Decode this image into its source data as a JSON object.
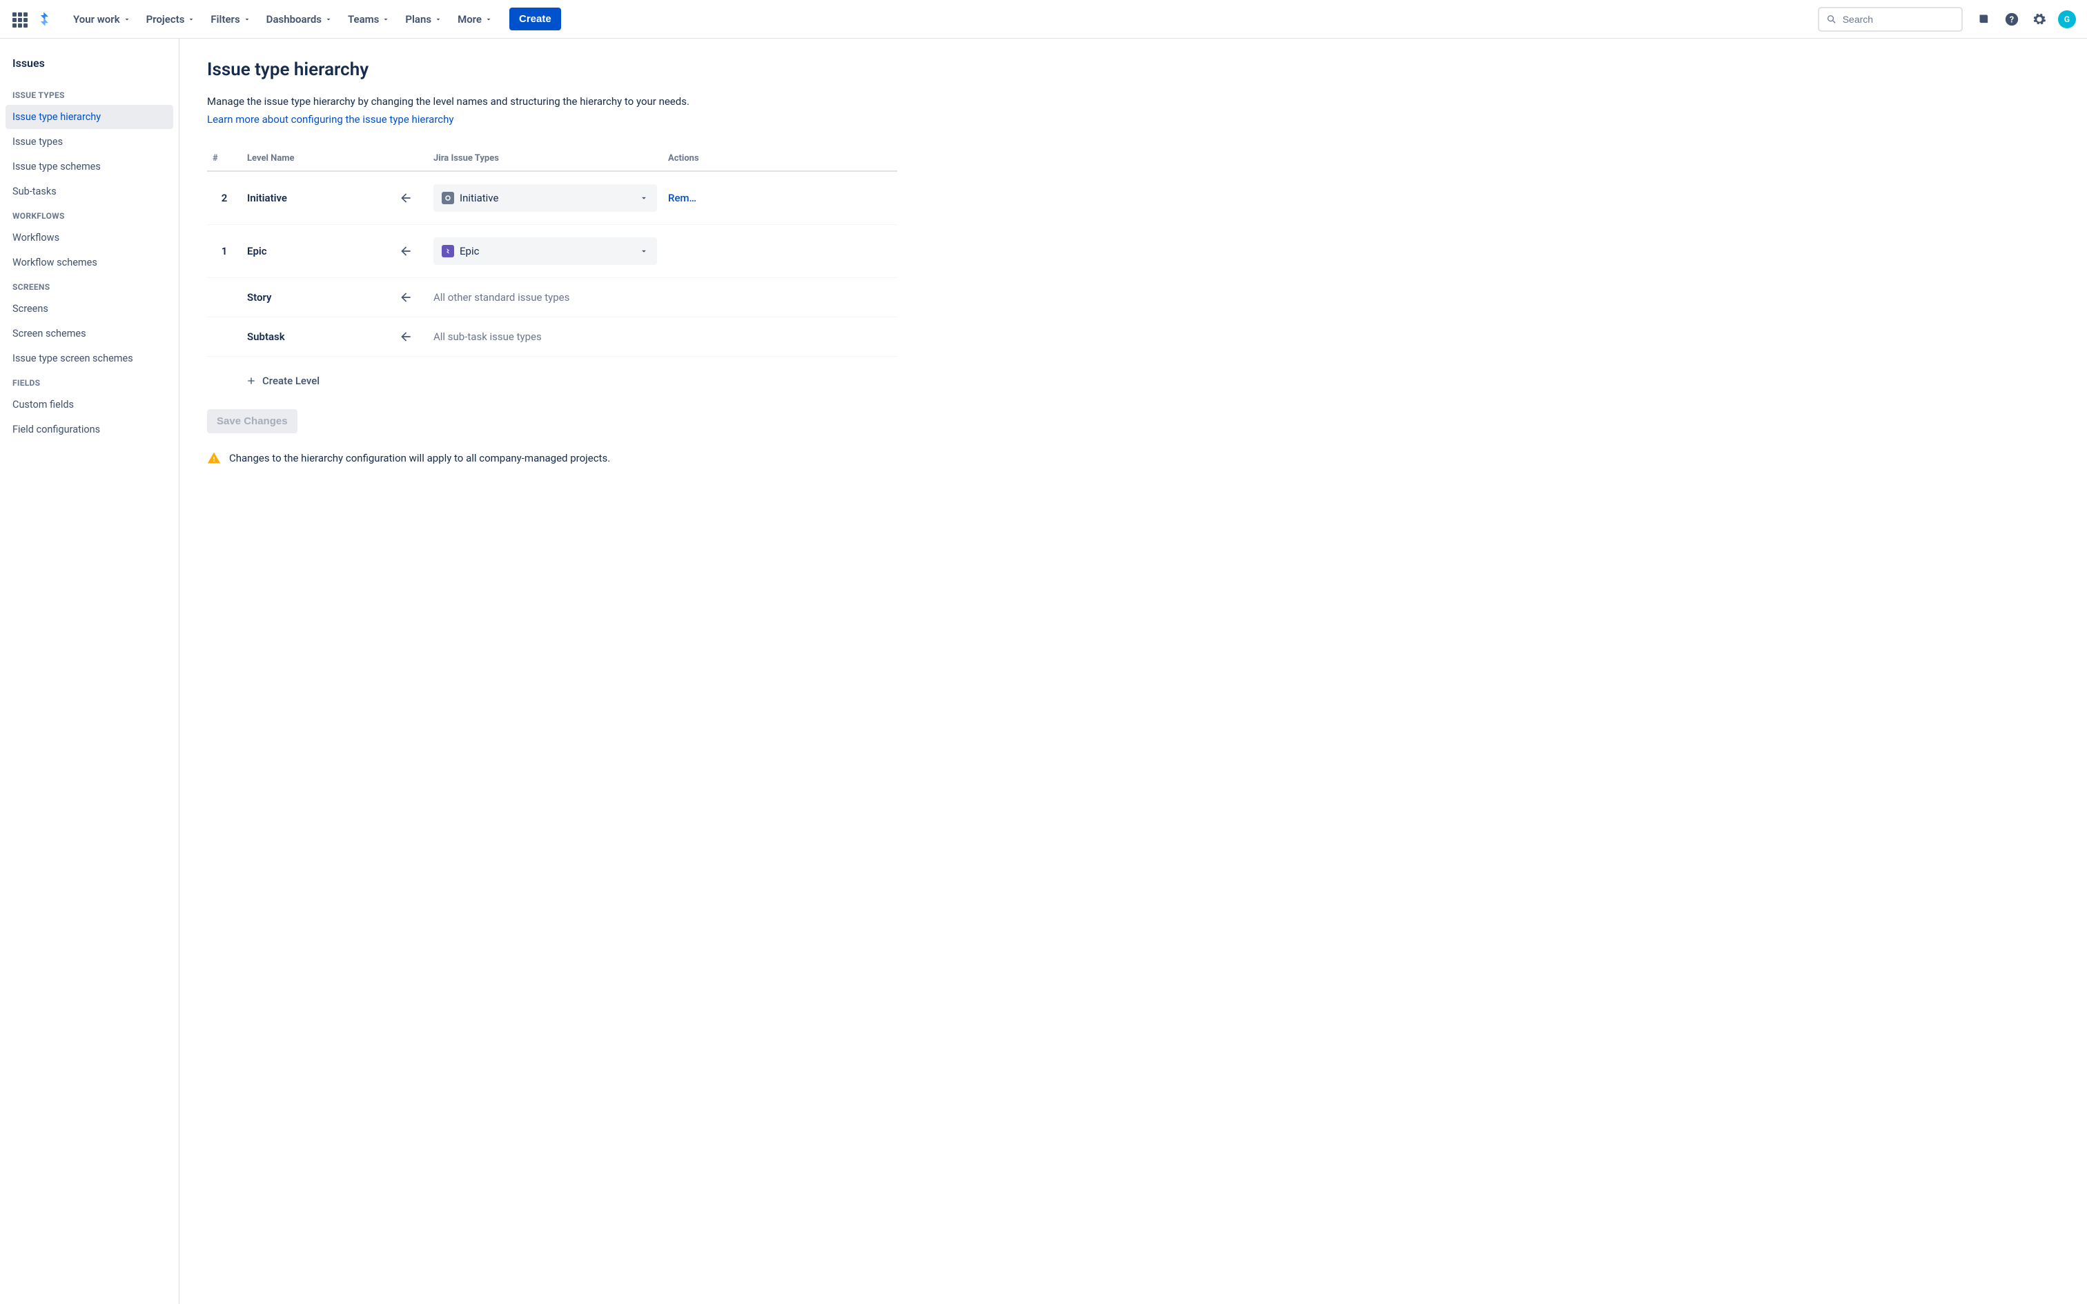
{
  "nav": {
    "links": [
      "Your work",
      "Projects",
      "Filters",
      "Dashboards",
      "Teams",
      "Plans",
      "More"
    ],
    "create": "Create",
    "search_placeholder": "Search",
    "avatar_initial": "G"
  },
  "sidebar": {
    "title": "Issues",
    "groups": [
      {
        "heading": "ISSUE TYPES",
        "items": [
          "Issue type hierarchy",
          "Issue types",
          "Issue type schemes",
          "Sub-tasks"
        ],
        "selected_index": 0
      },
      {
        "heading": "WORKFLOWS",
        "items": [
          "Workflows",
          "Workflow schemes"
        ],
        "selected_index": -1
      },
      {
        "heading": "SCREENS",
        "items": [
          "Screens",
          "Screen schemes",
          "Issue type screen schemes"
        ],
        "selected_index": -1
      },
      {
        "heading": "FIELDS",
        "items": [
          "Custom fields",
          "Field configurations"
        ],
        "selected_index": -1
      }
    ]
  },
  "main": {
    "title": "Issue type hierarchy",
    "description": "Manage the issue type hierarchy by changing the level names and structuring the hierarchy to your needs.",
    "learn_link": "Learn more about configuring the issue type hierarchy",
    "columns": {
      "num": "#",
      "name": "Level Name",
      "types": "Jira Issue Types",
      "actions": "Actions"
    },
    "rows": [
      {
        "num": "2",
        "name": "Initiative",
        "type_select": {
          "label": "Initiative",
          "icon": "initiative"
        },
        "action": "Rem…"
      },
      {
        "num": "1",
        "name": "Epic",
        "type_select": {
          "label": "Epic",
          "icon": "epic"
        },
        "action": ""
      },
      {
        "num": "",
        "name": "Story",
        "static_text": "All other standard issue types",
        "action": ""
      },
      {
        "num": "",
        "name": "Subtask",
        "static_text": "All sub-task issue types",
        "action": ""
      }
    ],
    "create_level": "Create Level",
    "save": "Save Changes",
    "warning": "Changes to the hierarchy configuration will apply to all company-managed projects."
  }
}
